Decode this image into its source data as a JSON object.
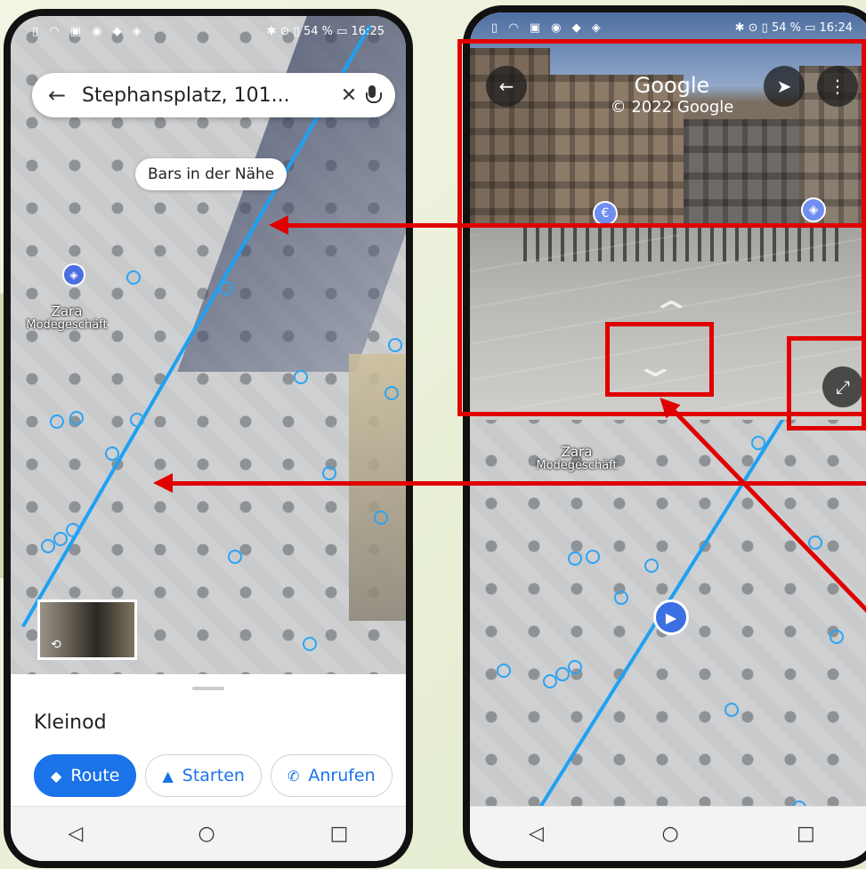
{
  "left_phone": {
    "status_bar": {
      "battery": "54 %",
      "time": "16:25"
    },
    "search": {
      "query": "Stephansplatz, 101...",
      "back_glyph": "←",
      "clear_glyph": "✕"
    },
    "chip_label": "Bars in der Nähe",
    "place": {
      "name": "Zara",
      "category": "Modegeschäft"
    },
    "sheet": {
      "title": "Kleinod",
      "buttons": [
        {
          "label": "Route",
          "icon": "route-icon"
        },
        {
          "label": "Starten",
          "icon": "navigation-arrow-icon"
        },
        {
          "label": "Anrufen",
          "icon": "phone-icon"
        }
      ]
    },
    "thumbnail_icon": "360-rotate-icon"
  },
  "right_phone": {
    "status_bar": {
      "battery": "54 %",
      "time": "16:24"
    },
    "street_view": {
      "brand": "Google",
      "copyright": "© 2022 Google",
      "back_glyph": "←",
      "compass_icon": "compass-icon",
      "menu_glyph": "⋮",
      "expand_glyph": "⤢",
      "poi_left_glyph": "€",
      "poi_right_glyph": "🛍"
    },
    "place": {
      "name": "Zara",
      "category": "Modegeschäft"
    }
  },
  "navbar": {
    "back": "◁",
    "home": "○",
    "recents": "□"
  },
  "colors": {
    "route": "#1ea1f2",
    "accent": "#1a73e8",
    "annotation": "#e00000"
  }
}
